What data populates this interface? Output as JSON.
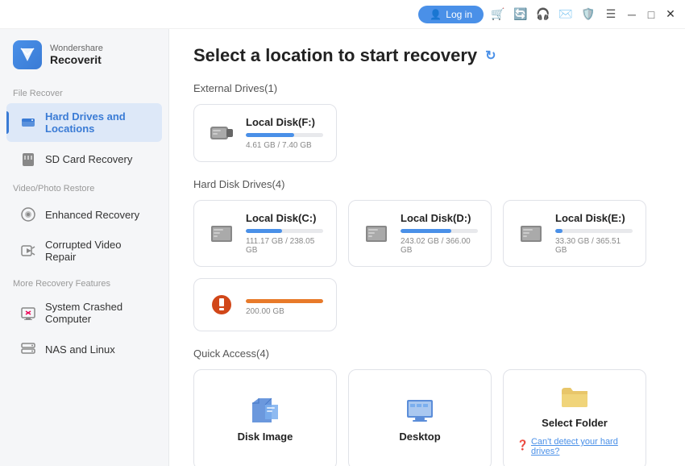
{
  "titlebar": {
    "login_label": "Log in",
    "icons": [
      "cart",
      "rotate",
      "headset",
      "email",
      "shield",
      "list",
      "minimize",
      "maximize",
      "close"
    ]
  },
  "sidebar": {
    "logo": {
      "brand": "Wondershare",
      "product": "Recoverit"
    },
    "sections": [
      {
        "label": "File Recover",
        "items": [
          {
            "id": "hard-drives",
            "label": "Hard Drives and Locations",
            "active": true
          },
          {
            "id": "sd-card",
            "label": "SD Card Recovery",
            "active": false
          }
        ]
      },
      {
        "label": "Video/Photo Restore",
        "items": [
          {
            "id": "enhanced-recovery",
            "label": "Enhanced Recovery",
            "active": false
          },
          {
            "id": "corrupted-video",
            "label": "Corrupted Video Repair",
            "active": false
          }
        ]
      },
      {
        "label": "More Recovery Features",
        "items": [
          {
            "id": "system-crashed",
            "label": "System Crashed Computer",
            "active": false
          },
          {
            "id": "nas-linux",
            "label": "NAS and Linux",
            "active": false
          }
        ]
      }
    ]
  },
  "content": {
    "page_title": "Select a location to start recovery",
    "sections": [
      {
        "id": "external-drives",
        "label": "External Drives(1)",
        "drives": [
          {
            "name": "Local Disk(F:)",
            "used_pct": 62,
            "bar_color": "fill-blue",
            "size_label": "4.61 GB / 7.40 GB",
            "icon_type": "external"
          }
        ]
      },
      {
        "id": "hard-disk-drives",
        "label": "Hard Disk Drives(4)",
        "drives": [
          {
            "name": "Local Disk(C:)",
            "used_pct": 47,
            "bar_color": "fill-blue",
            "size_label": "111.17 GB / 238.05 GB",
            "icon_type": "hdd"
          },
          {
            "name": "Local Disk(D:)",
            "used_pct": 66,
            "bar_color": "fill-blue",
            "size_label": "243.02 GB / 366.00 GB",
            "icon_type": "hdd"
          },
          {
            "name": "Local Disk(E:)",
            "used_pct": 9,
            "bar_color": "fill-blue",
            "size_label": "33.30 GB / 365.51 GB",
            "icon_type": "hdd"
          },
          {
            "name": "",
            "used_pct": 100,
            "bar_color": "fill-orange",
            "size_label": "200.00 GB",
            "icon_type": "no-label"
          }
        ]
      },
      {
        "id": "quick-access",
        "label": "Quick Access(4)",
        "items": [
          {
            "id": "disk-image",
            "label": "Disk Image",
            "icon": "disk-image"
          },
          {
            "id": "desktop",
            "label": "Desktop",
            "icon": "desktop"
          },
          {
            "id": "select-folder",
            "label": "Select Folder",
            "icon": "folder"
          }
        ]
      }
    ],
    "cant_detect_label": "Can't detect your hard drives?"
  }
}
